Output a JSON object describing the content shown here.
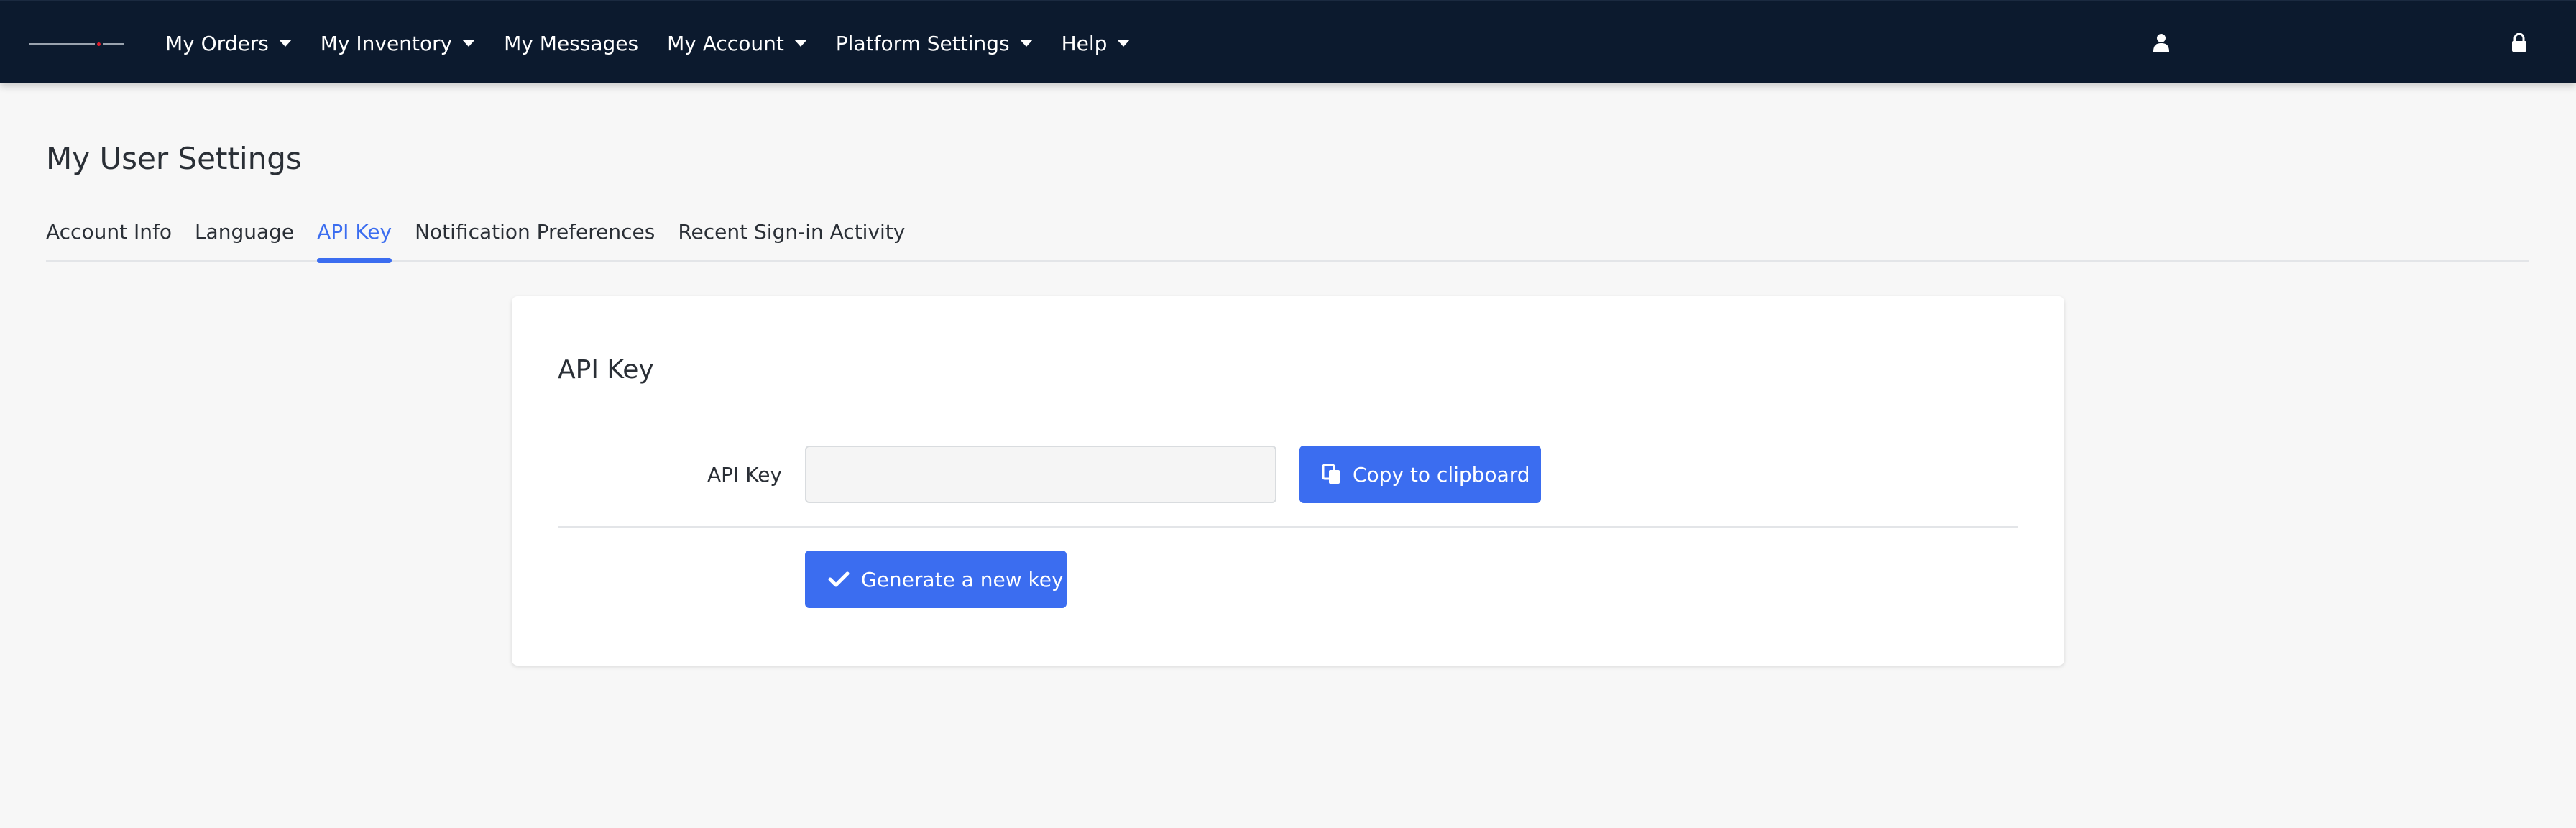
{
  "header": {
    "nav": [
      {
        "label": "My Orders",
        "dropdown": true
      },
      {
        "label": "My Inventory",
        "dropdown": true
      },
      {
        "label": "My Messages",
        "dropdown": false
      },
      {
        "label": "My Account",
        "dropdown": true
      },
      {
        "label": "Platform Settings",
        "dropdown": true
      },
      {
        "label": "Help",
        "dropdown": true
      }
    ],
    "icons": [
      "user-icon",
      "lock-icon"
    ]
  },
  "page": {
    "title": "My User Settings",
    "tabs": [
      {
        "label": "Account Info",
        "active": false
      },
      {
        "label": "Language",
        "active": false
      },
      {
        "label": "API Key",
        "active": true
      },
      {
        "label": "Notification Preferences",
        "active": false
      },
      {
        "label": "Recent Sign-in Activity",
        "active": false
      }
    ]
  },
  "api_card": {
    "title": "API Key",
    "field_label": "API Key",
    "field_value": "",
    "copy_label": "Copy to clipboard",
    "generate_label": "Generate a new key"
  },
  "colors": {
    "header_bg": "#0c1a2e",
    "accent": "#3b6df0",
    "page_bg": "#f7f7f7"
  }
}
